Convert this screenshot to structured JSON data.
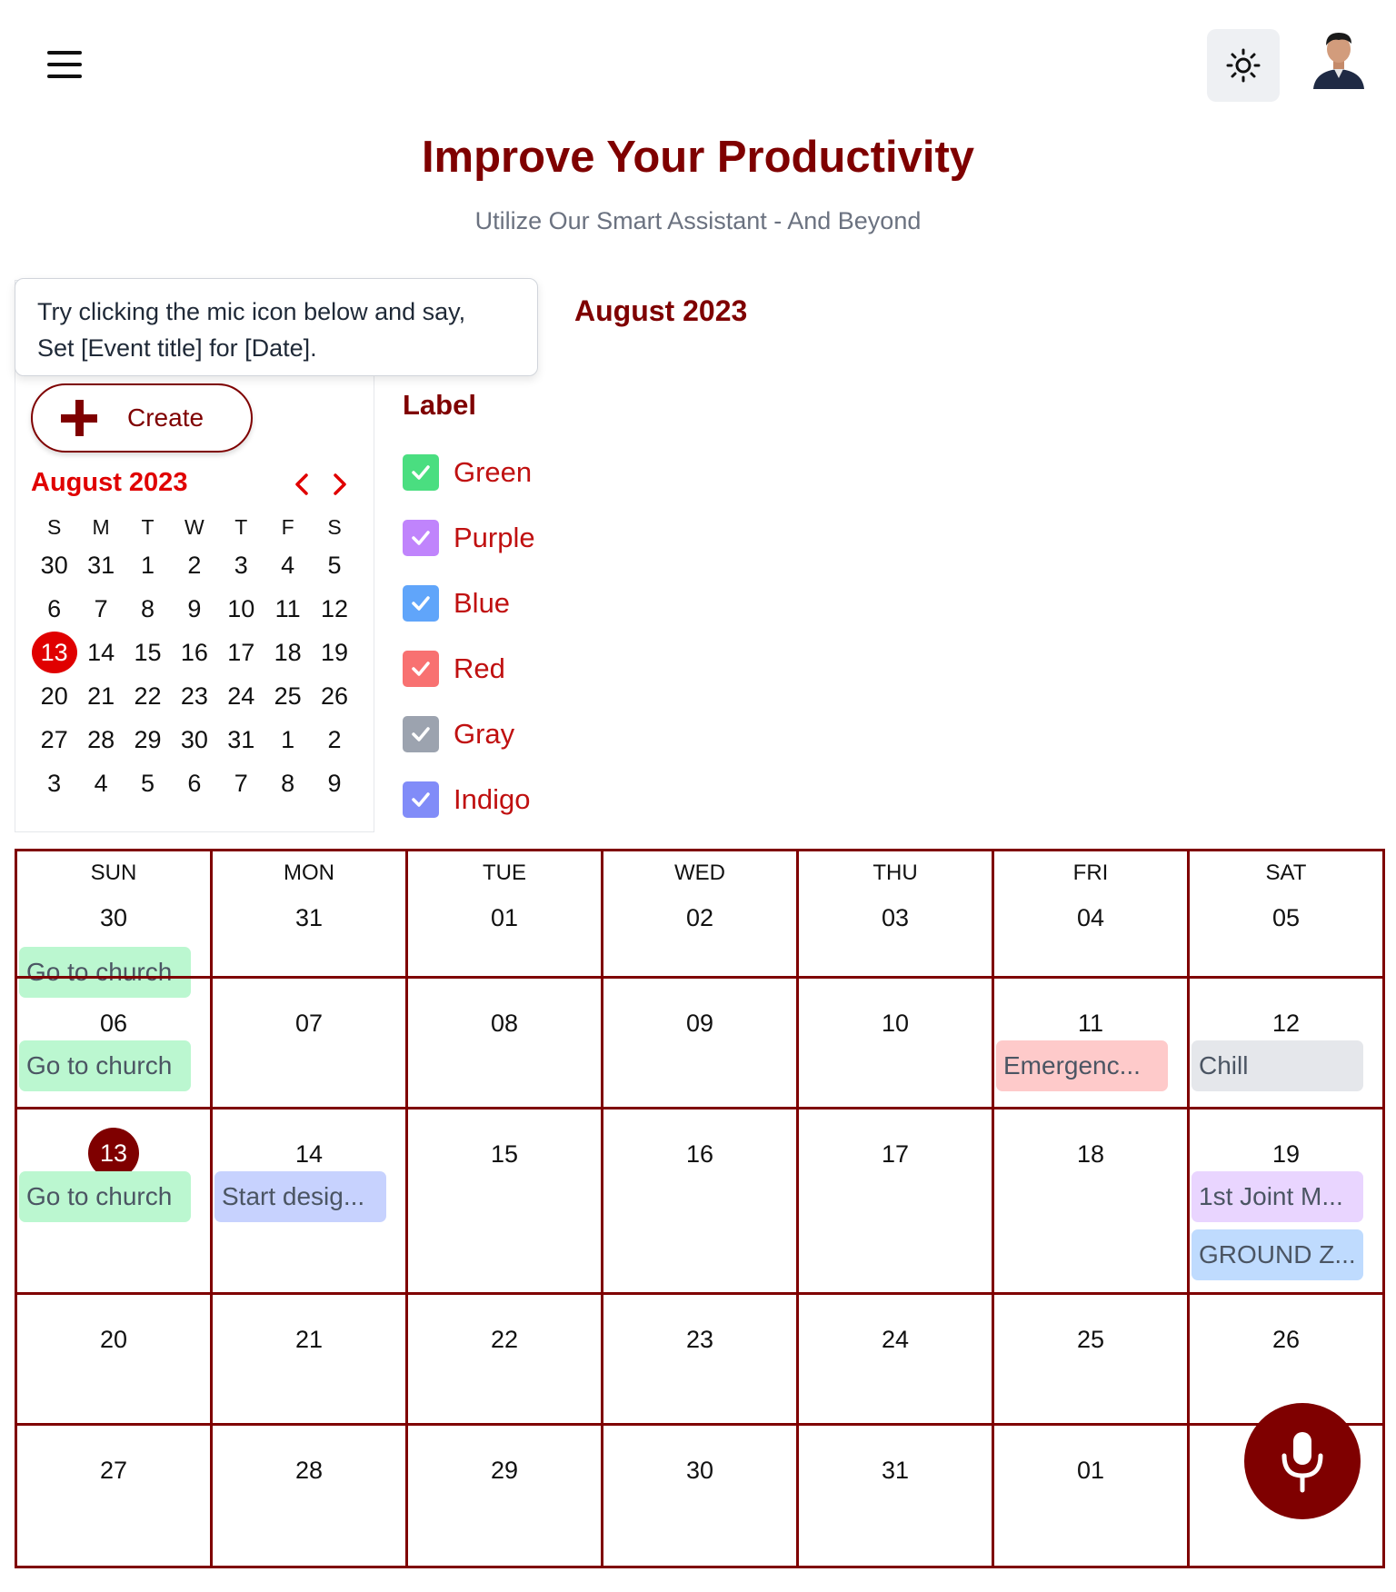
{
  "header": {
    "title": "Improve Your Productivity",
    "subtitle": "Utilize Our Smart Assistant - And Beyond"
  },
  "icons": {
    "menu": "hamburger-icon",
    "theme": "sun-icon",
    "avatar": "user-avatar",
    "create": "plus-icon",
    "prev": "chevron-left-icon",
    "next": "chevron-right-icon",
    "check": "check-icon",
    "mic": "microphone-icon"
  },
  "colors": {
    "brand": "#7f0000",
    "accent_red": "#e00000",
    "label_text": "#c01010"
  },
  "tooltip": {
    "line1": "Try clicking the mic icon below and say,",
    "line2": "Set [Event title] for [Date]."
  },
  "create": {
    "label": "Create"
  },
  "mini_calendar": {
    "title": "August 2023",
    "weekdays": [
      "S",
      "M",
      "T",
      "W",
      "T",
      "F",
      "S"
    ],
    "weeks": [
      [
        "30",
        "31",
        "1",
        "2",
        "3",
        "4",
        "5"
      ],
      [
        "6",
        "7",
        "8",
        "9",
        "10",
        "11",
        "12"
      ],
      [
        "13",
        "14",
        "15",
        "16",
        "17",
        "18",
        "19"
      ],
      [
        "20",
        "21",
        "22",
        "23",
        "24",
        "25",
        "26"
      ],
      [
        "27",
        "28",
        "29",
        "30",
        "31",
        "1",
        "2"
      ],
      [
        "3",
        "4",
        "5",
        "6",
        "7",
        "8",
        "9"
      ]
    ],
    "today": "13"
  },
  "labels": {
    "title": "Label",
    "items": [
      {
        "name": "Green",
        "color": "#4ade80",
        "checked": true
      },
      {
        "name": "Purple",
        "color": "#c084fc",
        "checked": true
      },
      {
        "name": "Blue",
        "color": "#60a5fa",
        "checked": true
      },
      {
        "name": "Red",
        "color": "#f87171",
        "checked": true
      },
      {
        "name": "Gray",
        "color": "#9ca3af",
        "checked": true
      },
      {
        "name": "Indigo",
        "color": "#818cf8",
        "checked": true
      }
    ]
  },
  "main": {
    "month_title": "August 2023",
    "weekdays": [
      "SUN",
      "MON",
      "TUE",
      "WED",
      "THU",
      "FRI",
      "SAT"
    ],
    "weeks": [
      [
        "30",
        "31",
        "01",
        "02",
        "03",
        "04",
        "05"
      ],
      [
        "06",
        "07",
        "08",
        "09",
        "10",
        "11",
        "12"
      ],
      [
        "13",
        "14",
        "15",
        "16",
        "17",
        "18",
        "19"
      ],
      [
        "20",
        "21",
        "22",
        "23",
        "24",
        "25",
        "26"
      ],
      [
        "27",
        "28",
        "29",
        "30",
        "31",
        "01",
        ""
      ]
    ],
    "today": "13",
    "events": [
      {
        "week": 0,
        "day": 0,
        "title": "Go to church",
        "bg": "#bbf7d0"
      },
      {
        "week": 1,
        "day": 0,
        "title": "Go to church",
        "bg": "#bbf7d0"
      },
      {
        "week": 1,
        "day": 5,
        "title": "Emergenc...",
        "bg": "#fecaca"
      },
      {
        "week": 1,
        "day": 6,
        "title": "Chill",
        "bg": "#e5e7eb"
      },
      {
        "week": 2,
        "day": 0,
        "title": "Go to church",
        "bg": "#bbf7d0"
      },
      {
        "week": 2,
        "day": 1,
        "title": "Start desig...",
        "bg": "#c7d2fe"
      },
      {
        "week": 2,
        "day": 6,
        "title": "1st Joint M...",
        "bg": "#e9d5ff"
      },
      {
        "week": 2,
        "day": 6,
        "title": "GROUND Z...",
        "bg": "#bfdbfe"
      }
    ]
  }
}
